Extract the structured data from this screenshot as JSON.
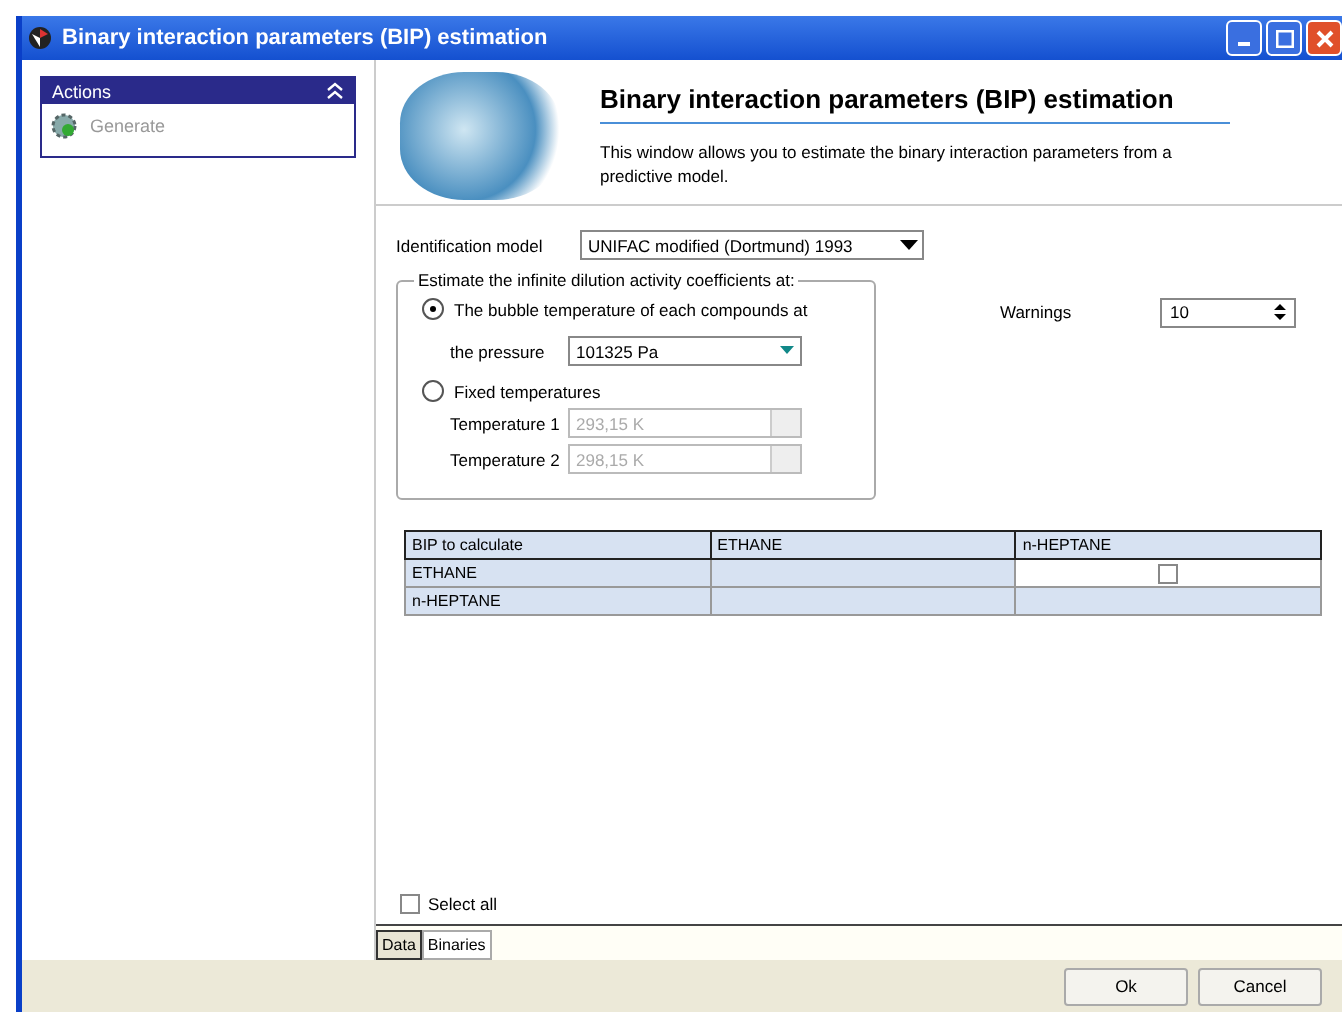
{
  "window": {
    "title": "Binary interaction parameters (BIP) estimation"
  },
  "sidebar": {
    "title": "Actions",
    "collapsed": false,
    "items": [
      {
        "label": "Generate",
        "disabled": true
      }
    ]
  },
  "header": {
    "title": "Binary interaction parameters (BIP) estimation",
    "description": "This window allows you to estimate the binary interaction parameters from a predictive model."
  },
  "identification_model": {
    "label": "Identification model",
    "value": "UNIFAC modified (Dortmund) 1993"
  },
  "estimate_group": {
    "legend": "Estimate the infinite dilution activity coefficients at:",
    "options": [
      {
        "label": "The bubble temperature of each compounds at",
        "selected": true
      },
      {
        "label": "Fixed temperatures",
        "selected": false
      }
    ],
    "pressure": {
      "label": "the pressure",
      "value": "101325 Pa"
    },
    "temperatures": [
      {
        "label": "Temperature 1",
        "value": "293,15 K",
        "disabled": true
      },
      {
        "label": "Temperature 2",
        "value": "298,15 K",
        "disabled": true
      }
    ]
  },
  "warnings": {
    "label": "Warnings",
    "value": "10"
  },
  "table": {
    "columns": [
      "BIP to calculate",
      "ETHANE",
      "n-HEPTANE"
    ],
    "rows": [
      {
        "label": "ETHANE",
        "cells": [
          {
            "kind": "empty"
          },
          {
            "kind": "checkbox",
            "checked": false
          }
        ]
      },
      {
        "label": "n-HEPTANE",
        "cells": [
          {
            "kind": "empty"
          },
          {
            "kind": "empty"
          }
        ]
      }
    ]
  },
  "select_all": {
    "label": "Select all",
    "checked": false
  },
  "tabs": [
    {
      "label": "Data",
      "selected": true
    },
    {
      "label": "Binaries",
      "selected": false
    }
  ],
  "buttons": [
    "Ok",
    "Cancel"
  ]
}
